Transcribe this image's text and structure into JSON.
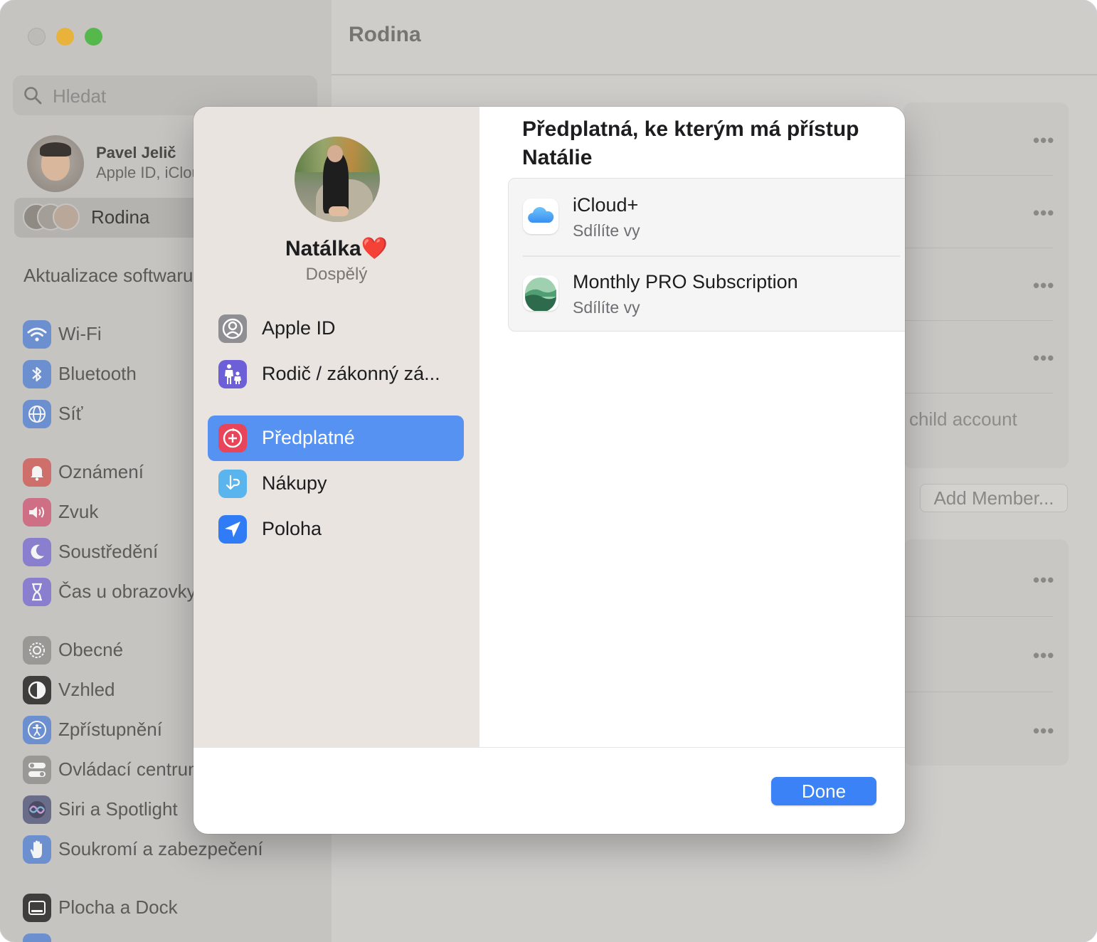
{
  "window": {
    "title": "Rodina",
    "traffic_lights": [
      "close",
      "minimize",
      "zoom"
    ]
  },
  "sidebar": {
    "search_placeholder": "Hledat",
    "profile": {
      "name": "Pavel Jelič",
      "subtitle": "Apple ID, iCloud+..."
    },
    "family_label": "Rodina",
    "software_update": "Aktualizace softwaru",
    "groups": [
      [
        {
          "label": "Wi-Fi",
          "icon": "wifi-icon",
          "color": "#6b8fcf"
        },
        {
          "label": "Bluetooth",
          "icon": "bluetooth-icon",
          "color": "#6b8fcf"
        },
        {
          "label": "Síť",
          "icon": "globe-icon",
          "color": "#6b8fcf"
        }
      ],
      [
        {
          "label": "Oznámení",
          "icon": "bell-icon",
          "color": "#cf6f6c"
        },
        {
          "label": "Zvuk",
          "icon": "speaker-icon",
          "color": "#cf6f86"
        },
        {
          "label": "Soustředění",
          "icon": "moon-icon",
          "color": "#8a7fcf"
        },
        {
          "label": "Čas u obrazovky",
          "icon": "hourglass-icon",
          "color": "#8a7fcf"
        }
      ],
      [
        {
          "label": "Obecné",
          "icon": "gear-icon",
          "color": "#9a9894"
        },
        {
          "label": "Vzhled",
          "icon": "appearance-icon",
          "color": "#3f3e3c"
        },
        {
          "label": "Zpřístupnění",
          "icon": "accessibility-icon",
          "color": "#6b8fcf"
        },
        {
          "label": "Ovládací centrum",
          "icon": "toggles-icon",
          "color": "#9a9894"
        },
        {
          "label": "Siri a Spotlight",
          "icon": "siri-icon",
          "color": "#6a6d8a"
        },
        {
          "label": "Soukromí a zabezpečení",
          "icon": "hand-icon",
          "color": "#6b8fcf"
        }
      ],
      [
        {
          "label": "Plocha a Dock",
          "icon": "dock-icon",
          "color": "#3f3e3c"
        }
      ]
    ]
  },
  "main": {
    "child_account_text": "child account",
    "add_member_label": "Add Member...",
    "more_button": "•••"
  },
  "modal": {
    "member_name": "Natálka❤️",
    "member_role": "Dospělý",
    "nav": [
      {
        "label": "Apple ID",
        "icon": "person-circle-icon",
        "selected": false
      },
      {
        "label": "Rodič / zákonný zá...",
        "icon": "parent-child-icon",
        "selected": false
      },
      {
        "label": "Předplatné",
        "icon": "subscription-icon",
        "selected": true
      },
      {
        "label": "Nákupy",
        "icon": "purchases-icon",
        "selected": false
      },
      {
        "label": "Poloha",
        "icon": "location-arrow-icon",
        "selected": false
      }
    ],
    "title": "Předplatná, ke kterým má přístup Natálie",
    "subscriptions": [
      {
        "name": "iCloud+",
        "status": "Sdílíte vy",
        "icon": "icloud-icon"
      },
      {
        "name": "Monthly PRO Subscription",
        "status": "Sdílíte vy",
        "icon": "landscape-app-icon"
      }
    ],
    "done_label": "Done"
  }
}
